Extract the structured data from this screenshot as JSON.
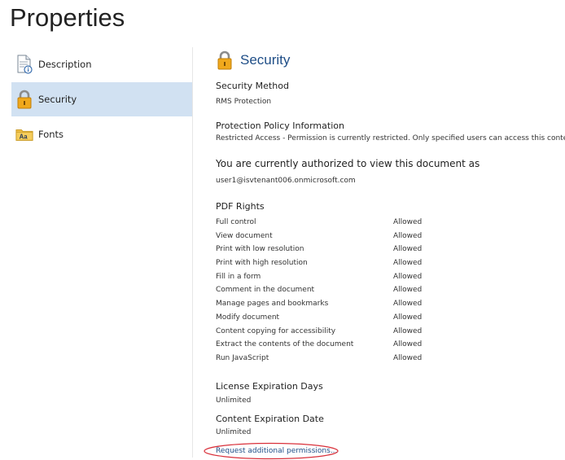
{
  "page": {
    "title": "Properties"
  },
  "nav": {
    "items": [
      {
        "id": "description",
        "label": "Description",
        "icon": "document-info-icon",
        "selected": false
      },
      {
        "id": "security",
        "label": "Security",
        "icon": "lock-icon",
        "selected": true
      },
      {
        "id": "fonts",
        "label": "Fonts",
        "icon": "font-folder-icon",
        "selected": false
      }
    ]
  },
  "security": {
    "title": "Security",
    "icon": "lock-icon",
    "method_label": "Security Method",
    "method_value": "RMS Protection",
    "policy_label": "Protection Policy Information",
    "policy_value": "Restricted Access - Permission is currently restricted. Only specified users can access this content.",
    "authorized_label": "You are currently authorized to view this document as",
    "authorized_value": "user1@isvtenant006.onmicrosoft.com",
    "rights_label": "PDF Rights",
    "rights": [
      {
        "name": "Full control",
        "status": "Allowed"
      },
      {
        "name": "View document",
        "status": "Allowed"
      },
      {
        "name": "Print with low resolution",
        "status": "Allowed"
      },
      {
        "name": "Print with high resolution",
        "status": "Allowed"
      },
      {
        "name": "Fill in a form",
        "status": "Allowed"
      },
      {
        "name": "Comment in the document",
        "status": "Allowed"
      },
      {
        "name": "Manage pages and bookmarks",
        "status": "Allowed"
      },
      {
        "name": "Modify document",
        "status": "Allowed"
      },
      {
        "name": "Content copying for accessibility",
        "status": "Allowed"
      },
      {
        "name": "Extract the contents of the document",
        "status": "Allowed"
      },
      {
        "name": "Run JavaScript",
        "status": "Allowed"
      }
    ],
    "license_label": "License Expiration Days",
    "license_value": "Unlimited",
    "content_exp_label": "Content Expiration Date",
    "content_exp_value": "Unlimited",
    "request_link": "Request additional permissions..."
  },
  "colors": {
    "accent": "#1f4e87",
    "selected_bg": "#d1e1f2",
    "highlight": "#d9303a",
    "lock": "#e8a317"
  }
}
